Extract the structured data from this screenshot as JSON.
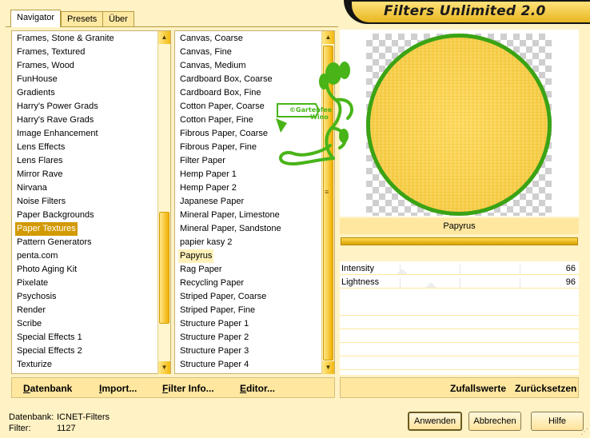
{
  "tabs": [
    {
      "label": "Navigator",
      "active": true
    },
    {
      "label": "Presets",
      "active": false
    },
    {
      "label": "Über",
      "active": false
    }
  ],
  "title": "Filters Unlimited 2.0",
  "categories": {
    "items": [
      "Frames, Stone & Granite",
      "Frames, Textured",
      "Frames, Wood",
      "FunHouse",
      "Gradients",
      "Harry's Power Grads",
      "Harry's Rave Grads",
      "Image Enhancement",
      "Lens Effects",
      "Lens Flares",
      "Mirror Rave",
      "Nirvana",
      "Noise Filters",
      "Paper Backgrounds",
      "Paper Textures",
      "Pattern Generators",
      "penta.com",
      "Photo Aging Kit",
      "Pixelate",
      "Psychosis",
      "Render",
      "Scribe",
      "Special Effects 1",
      "Special Effects 2",
      "Texturize"
    ],
    "selected": "Paper Textures"
  },
  "filters": {
    "items": [
      "Canvas, Coarse",
      "Canvas, Fine",
      "Canvas, Medium",
      "Cardboard Box, Coarse",
      "Cardboard Box, Fine",
      "Cotton Paper, Coarse",
      "Cotton Paper, Fine",
      "Fibrous Paper, Coarse",
      "Fibrous Paper, Fine",
      "Filter Paper",
      "Hemp Paper 1",
      "Hemp Paper 2",
      "Japanese Paper",
      "Mineral Paper, Limestone",
      "Mineral Paper, Sandstone",
      "papier kasy 2",
      "Papyrus",
      "Rag Paper",
      "Recycling Paper",
      "Striped Paper, Coarse",
      "Striped Paper, Fine",
      "Structure Paper 1",
      "Structure Paper 2",
      "Structure Paper 3",
      "Structure Paper 4"
    ],
    "selected": "Papyrus"
  },
  "bottom_buttons": {
    "datenbank": "Datenbank",
    "import": "Import...",
    "filter_info": "Filter Info...",
    "editor": "Editor...",
    "zufallswerte": "Zufallswerte",
    "zuruecksetzen": "Zurücksetzen"
  },
  "watermark": {
    "line1": "©Gartenfee",
    "line2": "Wino"
  },
  "current_filter": "Papyrus",
  "params": [
    {
      "label": "Intensity",
      "value": "66",
      "level": 0.26
    },
    {
      "label": "Lightness",
      "value": "96",
      "level": 0.38
    }
  ],
  "footer": {
    "db_label": "Datenbank:",
    "db_value": "ICNET-Filters",
    "filter_label": "Filter:",
    "filter_value": "1127",
    "ok": "Anwenden",
    "cancel": "Abbrechen",
    "help": "Hilfe"
  },
  "colors": {
    "background": "#fff2c4",
    "accent": "#d29a00",
    "preview_fill": "#f7cd45",
    "preview_ring": "#3aa315",
    "watermark": "#48b418"
  }
}
